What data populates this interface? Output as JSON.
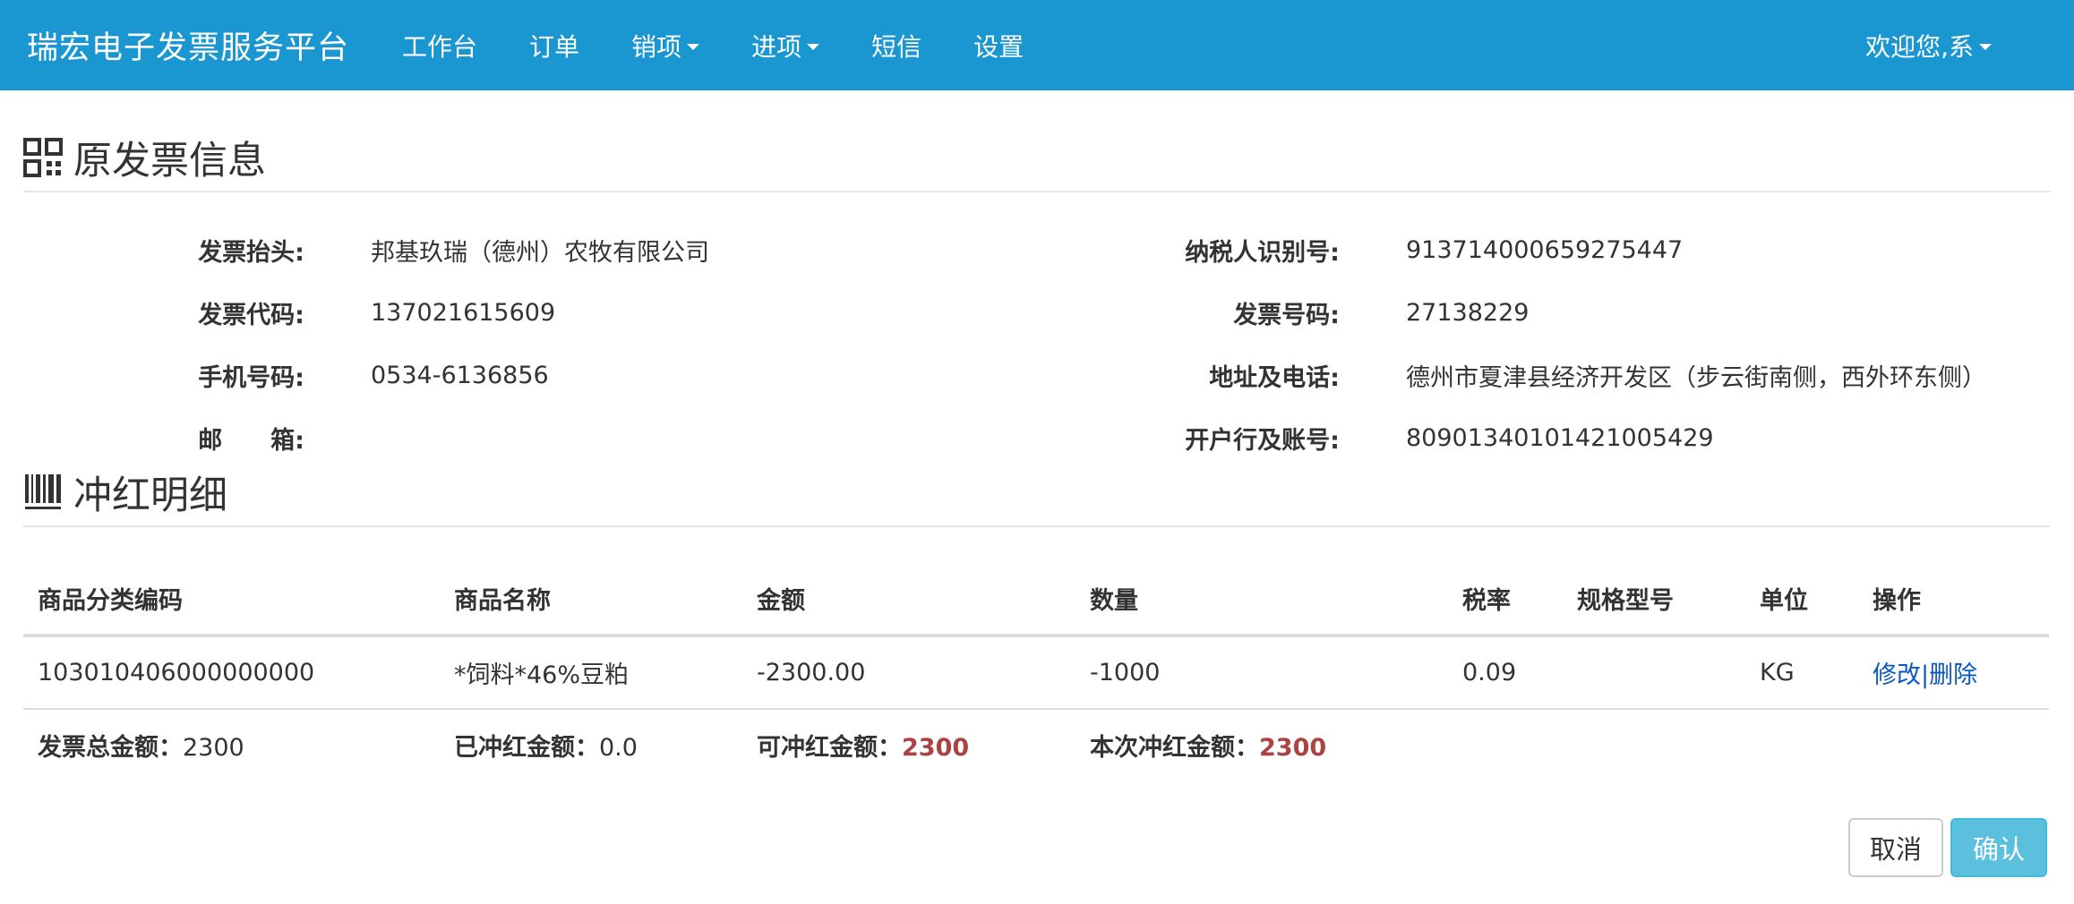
{
  "navbar": {
    "brand": "瑞宏电子发票服务平台",
    "items": [
      {
        "label": "工作台"
      },
      {
        "label": "订单"
      },
      {
        "label": "销项"
      },
      {
        "label": "进项"
      },
      {
        "label": "短信"
      },
      {
        "label": "设置"
      }
    ],
    "user": "欢迎您,系"
  },
  "original_invoice": {
    "title": "原发票信息",
    "fields": {
      "header_label": "发票抬头:",
      "header_value": "邦基玖瑞（德州）农牧有限公司",
      "taxid_label": "纳税人识别号:",
      "taxid_value": "913714000659275447",
      "code_label": "发票代码:",
      "code_value": "137021615609",
      "number_label": "发票号码:",
      "number_value": "27138229",
      "phone_label": "手机号码:",
      "phone_value": "0534-6136856",
      "address_label": "地址及电话:",
      "address_value": "德州市夏津县经济开发区（步云街南侧，西外环东侧）",
      "email_label": "邮　　箱:",
      "email_value": "",
      "bank_label": "开户行及账号:",
      "bank_value": "80901340101421005429"
    }
  },
  "red_detail": {
    "title": "冲红明细",
    "columns": [
      "商品分类编码",
      "商品名称",
      "金额",
      "数量",
      "税率",
      "规格型号",
      "单位",
      "操作"
    ],
    "rows": [
      {
        "code": "103010406000000000",
        "name": "*饲料*46%豆粕",
        "amount": "-2300.00",
        "qty": "-1000",
        "rate": "0.09",
        "spec": "",
        "unit": "KG",
        "edit": "修改",
        "sep": "|",
        "del": "删除"
      }
    ],
    "summary": {
      "total_label": "发票总金额：",
      "total_value": "2300",
      "redded_label": "已冲红金额：",
      "redded_value": "0.0",
      "available_label": "可冲红金额：",
      "available_value": "2300",
      "current_label": "本次冲红金额：",
      "current_value": "2300"
    }
  },
  "buttons": {
    "cancel": "取消",
    "confirm": "确认"
  }
}
